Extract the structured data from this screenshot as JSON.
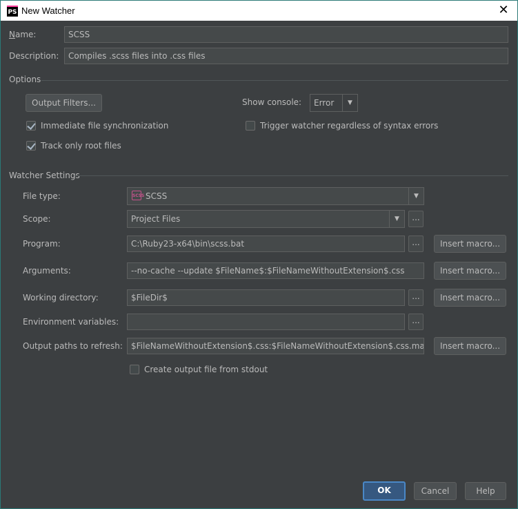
{
  "window": {
    "title": "New Watcher",
    "app_icon": "PS",
    "close_glyph": "✕"
  },
  "header": {
    "name_label": "Name:",
    "name_value": "SCSS",
    "description_label": "Description:",
    "description_value": "Compiles .scss files into .css files"
  },
  "options": {
    "section_title": "Options",
    "output_filters_label": "Output Filters...",
    "show_console_label": "Show console:",
    "show_console_value": "Error",
    "immediate_sync_label": "Immediate file synchronization",
    "immediate_sync_checked": true,
    "trigger_watcher_label": "Trigger watcher regardless of syntax errors",
    "trigger_watcher_checked": false,
    "track_root_label": "Track only root files",
    "track_root_checked": true
  },
  "watcher": {
    "section_title": "Watcher Settings",
    "file_type_label": "File type:",
    "file_type_value": "SCSS",
    "file_type_icon": "scss-icon",
    "file_type_icon_text": "SCSS",
    "scope_label": "Scope:",
    "scope_value": "Project Files",
    "program_label": "Program:",
    "program_value": "C:\\Ruby23-x64\\bin\\scss.bat",
    "arguments_label": "Arguments:",
    "arguments_value": "--no-cache --update $FileName$:$FileNameWithoutExtension$.css",
    "working_dir_label": "Working directory:",
    "working_dir_value": "$FileDir$",
    "env_vars_label": "Environment variables:",
    "env_vars_value": "",
    "output_paths_label": "Output paths to refresh:",
    "output_paths_value": "$FileNameWithoutExtension$.css:$FileNameWithoutExtension$.css.map",
    "create_output_label": "Create output file from stdout",
    "create_output_checked": false,
    "insert_macro_label": "Insert macro...",
    "browse_label": "..."
  },
  "footer": {
    "ok_label": "OK",
    "cancel_label": "Cancel",
    "help_label": "Help"
  }
}
